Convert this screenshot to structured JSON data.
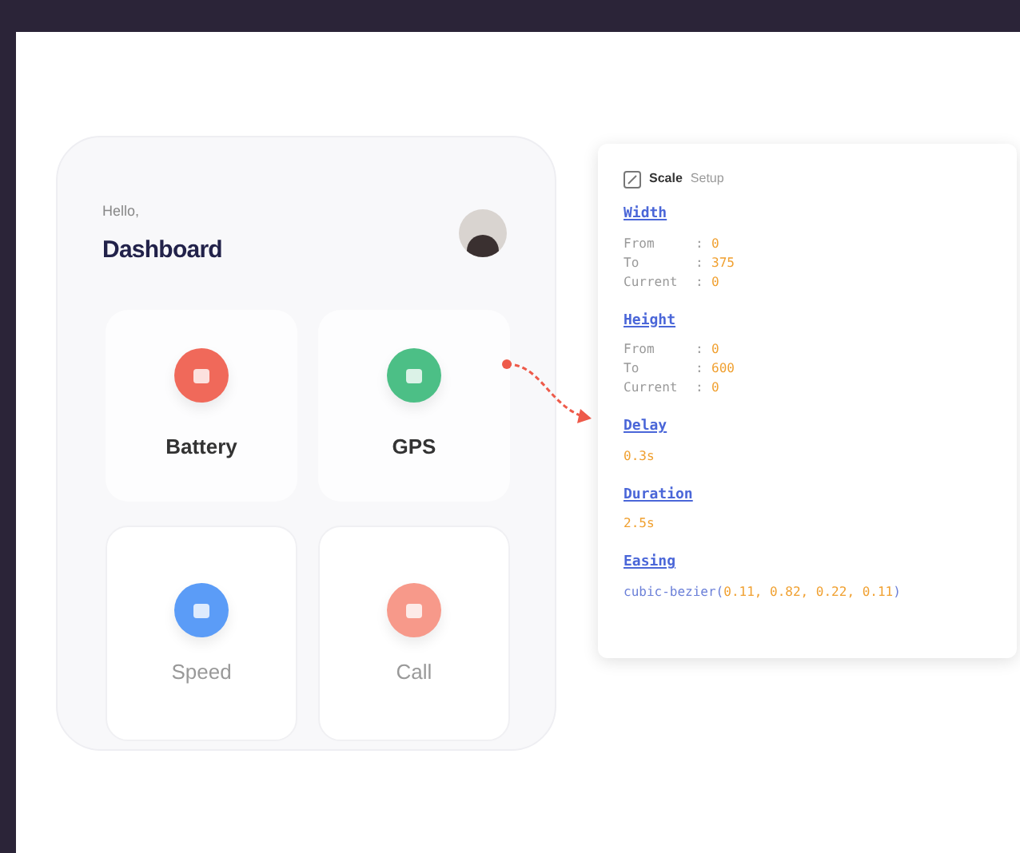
{
  "phone": {
    "greeting": "Hello,",
    "title": "Dashboard",
    "tiles": [
      {
        "label": "Battery",
        "color": "#f0695a"
      },
      {
        "label": "GPS",
        "color": "#4cbf86"
      },
      {
        "label": "Speed",
        "color": "#5b9cf7"
      },
      {
        "label": "Call",
        "color": "#f7998a"
      }
    ]
  },
  "inspector": {
    "title": "Scale",
    "subtitle": "Setup",
    "sections": [
      {
        "kind": "props",
        "heading": "Width",
        "rows": [
          {
            "key": "From",
            "sep": ":",
            "value": "0"
          },
          {
            "key": "To",
            "sep": ":",
            "value": "375"
          },
          {
            "key": "Current",
            "sep": ":",
            "value": "0"
          }
        ]
      },
      {
        "kind": "props",
        "heading": "Height",
        "rows": [
          {
            "key": "From",
            "sep": ":",
            "value": "0"
          },
          {
            "key": "To",
            "sep": ":",
            "value": "600"
          },
          {
            "key": "Current",
            "sep": ":",
            "value": "0"
          }
        ]
      },
      {
        "kind": "value",
        "heading": "Delay",
        "value": "0.3s"
      },
      {
        "kind": "value",
        "heading": "Duration",
        "value": "2.5s"
      },
      {
        "kind": "easing",
        "heading": "Easing",
        "fn": "cubic-bezier(",
        "args": "0.11, 0.82, 0.22, 0.11",
        "close": ")"
      }
    ]
  }
}
